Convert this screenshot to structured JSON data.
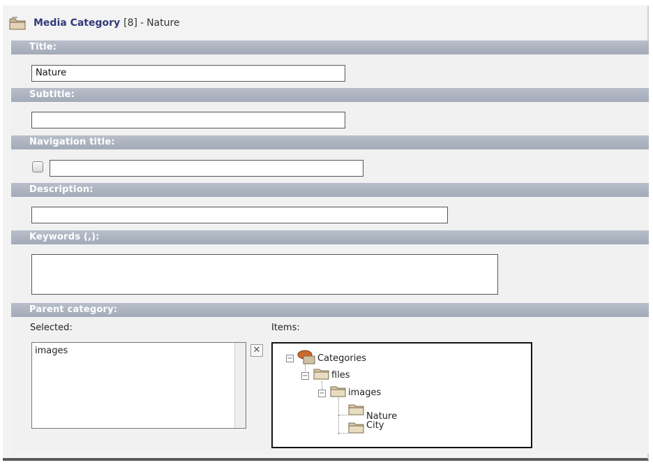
{
  "header": {
    "title": "Media Category",
    "id": "[8]",
    "separator": "-",
    "name": "Nature",
    "icon": "folder-icon"
  },
  "fields": {
    "title": {
      "label": "Title:",
      "value": "Nature"
    },
    "subtitle": {
      "label": "Subtitle:",
      "value": ""
    },
    "navigation_title": {
      "label": "Navigation title:",
      "value": "",
      "checked": false
    },
    "description": {
      "label": "Description:",
      "value": ""
    },
    "keywords": {
      "label": "Keywords (,):",
      "value": ""
    },
    "parent_category": {
      "label": "Parent category:",
      "selected_label": "Selected:",
      "items_label": "Items:",
      "selected_items": [
        "images"
      ],
      "remove_label": "✕",
      "tree": {
        "root": "Categories",
        "files": "files",
        "images": "images",
        "nature": "Nature",
        "city": "City"
      }
    }
  },
  "colors": {
    "band": "#a9b1bd",
    "title_text": "#333a7a",
    "background": "#f3f3f3"
  }
}
